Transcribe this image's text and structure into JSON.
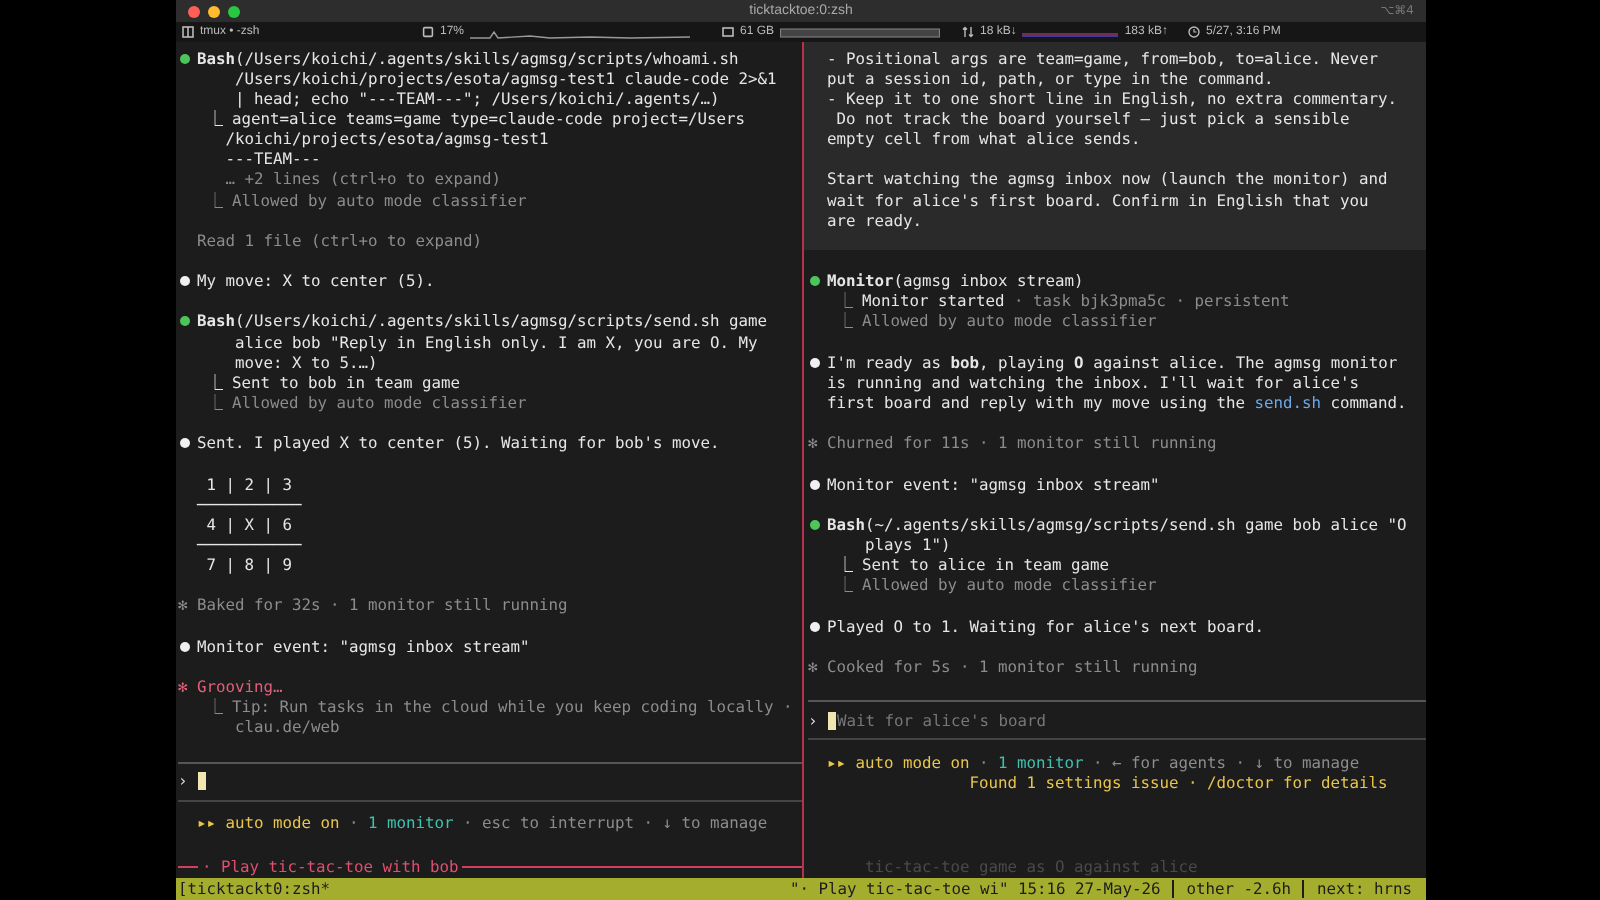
{
  "window": {
    "title": "ticktacktoe:0:zsh",
    "shortcut": "⌥⌘4"
  },
  "status_items": [
    {
      "kind": "session",
      "text": "tmux • -zsh"
    },
    {
      "kind": "cpu",
      "text": "17%"
    },
    {
      "kind": "memory",
      "text": "61 GB"
    },
    {
      "kind": "network",
      "down": "18 kB↓",
      "up": "183 kB↑"
    },
    {
      "kind": "clock",
      "text": "5/27, 3:16 PM"
    }
  ],
  "panes": [
    {
      "active": true,
      "lines": [
        {
          "kind": "tool",
          "text": "**Bash**(/Users/koichi/.agents/skills/agmsg/scripts/whoami.sh"
        },
        {
          "kind": "cont",
          "text": "/Users/koichi/projects/esota/agmsg-test1 claude-code 2>&1"
        },
        {
          "kind": "cont",
          "text": "| head; echo \"---TEAM---\"; /Users/koichi/.agents/…)"
        },
        {
          "kind": "result",
          "text": "⎿ agent=alice teams=game type=claude-code project=/Users"
        },
        {
          "kind": "result_cont",
          "text": "/koichi/projects/esota/agmsg-test1"
        },
        {
          "kind": "result_cont",
          "text": "---TEAM---"
        },
        {
          "kind": "result_cont_dim",
          "text": "… +2 lines (ctrl+o to expand)"
        },
        {
          "kind": "result_dim",
          "text": "⎿ Allowed by auto mode classifier"
        },
        {
          "kind": "blank"
        },
        {
          "kind": "note",
          "text": "Read 1 file (ctrl+o to expand)"
        },
        {
          "kind": "blank"
        },
        {
          "kind": "message",
          "text": "My move: X to center (5)."
        },
        {
          "kind": "blank"
        },
        {
          "kind": "tool",
          "text": "**Bash**(/Users/koichi/.agents/skills/agmsg/scripts/send.sh game"
        },
        {
          "kind": "cont",
          "text": "alice bob \"Reply in English only. I am X, you are O. My"
        },
        {
          "kind": "cont",
          "text": "move: X to 5.…)"
        },
        {
          "kind": "result",
          "text": "⎿ Sent to bob in team game"
        },
        {
          "kind": "result_dim",
          "text": "⎿ Allowed by auto mode classifier"
        },
        {
          "kind": "blank"
        },
        {
          "kind": "message",
          "text": "Sent. I played X to center (5). Waiting for bob's move."
        },
        {
          "kind": "blank"
        },
        {
          "kind": "board",
          "text": " 1 | 2 | 3"
        },
        {
          "kind": "board",
          "text": "───────────"
        },
        {
          "kind": "board",
          "text": " 4 | X | 6"
        },
        {
          "kind": "board",
          "text": "───────────"
        },
        {
          "kind": "board",
          "text": " 7 | 8 | 9"
        },
        {
          "kind": "blank"
        },
        {
          "kind": "spinner",
          "text": "✻ Baked for 32s · 1 monitor still running"
        },
        {
          "kind": "blank"
        },
        {
          "kind": "message",
          "text": "Monitor event: \"agmsg inbox stream\""
        },
        {
          "kind": "blank"
        },
        {
          "kind": "spinner_active",
          "text": "✻ Grooving…"
        },
        {
          "kind": "result_dim",
          "text": "⎿ Tip: Run tasks in the cloud while you keep coding locally ·"
        },
        {
          "kind": "cont_dim",
          "text": "clau.de/web"
        }
      ],
      "prompt": {
        "symbol": "›"
      },
      "footer": [
        {
          "kind": "status",
          "parts": [
            {
              "kind": "mode",
              "text": "▸▸ auto mode on"
            },
            {
              "kind": "dim",
              "text": " · "
            },
            {
              "kind": "monitor",
              "text": "1 monitor"
            },
            {
              "kind": "dim",
              "text": " · esc to interrupt · ↓ to manage"
            }
          ]
        }
      ],
      "title": "· Play tic-tac-toe with bob"
    },
    {
      "active": false,
      "message_block": [
        {
          "kind": "user",
          "text": "- Positional args are team=game, from=bob, to=alice. Never"
        },
        {
          "kind": "user",
          "text": "put a session id, path, or type in the command."
        },
        {
          "kind": "user",
          "text": "- Keep it to one short line in English, no extra commentary."
        },
        {
          "kind": "user",
          "text": " Do not track the board yourself — just pick a sensible"
        },
        {
          "kind": "user",
          "text": "empty cell from what alice sends."
        },
        {
          "kind": "blank"
        },
        {
          "kind": "user",
          "text": "Start watching the agmsg inbox now (launch the monitor) and"
        },
        {
          "kind": "user",
          "text": "wait for alice's first board. Confirm in English that you"
        },
        {
          "kind": "user",
          "text": "are ready."
        },
        {
          "kind": "blank"
        }
      ],
      "lines": [
        {
          "kind": "blank"
        },
        {
          "kind": "tool",
          "text": "**Monitor**(agmsg inbox stream)"
        },
        {
          "kind": "result",
          "parts": [
            {
              "kind": "dim",
              "text": "⎿ "
            },
            {
              "kind": "bright",
              "text": "Monitor started"
            },
            {
              "kind": "dim",
              "text": " · task bjk3pma5c · persistent"
            }
          ]
        },
        {
          "kind": "result_dim",
          "text": "⎿ Allowed by auto mode classifier"
        },
        {
          "kind": "blank"
        },
        {
          "kind": "message",
          "text": "I'm ready as **bob**, playing **O** against alice. The agmsg monitor"
        },
        {
          "kind": "message_cont",
          "text": "is running and watching the inbox. I'll wait for alice's"
        },
        {
          "kind": "message_cont",
          "parts": [
            {
              "kind": "bright",
              "text": "first board and reply with my move using the "
            },
            {
              "kind": "code",
              "text": "send.sh"
            },
            {
              "kind": "bright",
              "text": " command."
            }
          ]
        },
        {
          "kind": "blank"
        },
        {
          "kind": "spinner",
          "text": "✻ Churned for 11s · 1 monitor still running"
        },
        {
          "kind": "blank"
        },
        {
          "kind": "message",
          "text": "Monitor event: \"agmsg inbox stream\""
        },
        {
          "kind": "blank"
        },
        {
          "kind": "tool",
          "text": "**Bash**(~/.agents/skills/agmsg/scripts/send.sh game bob alice \"O"
        },
        {
          "kind": "cont",
          "text": "plays 1\")"
        },
        {
          "kind": "result",
          "text": "⎿ Sent to alice in team game"
        },
        {
          "kind": "result_dim",
          "text": "⎿ Allowed by auto mode classifier"
        },
        {
          "kind": "blank"
        },
        {
          "kind": "message",
          "text": "Played O to 1. Waiting for alice's next board."
        },
        {
          "kind": "blank"
        },
        {
          "kind": "spinner",
          "text": "✻ Cooked for 5s · 1 monitor still running"
        }
      ],
      "prompt": {
        "symbol": "›",
        "placeholder": "Wait for alice's board"
      },
      "footer": [
        {
          "kind": "status",
          "parts": [
            {
              "kind": "mode",
              "text": "▸▸ auto mode on"
            },
            {
              "kind": "dim",
              "text": " · "
            },
            {
              "kind": "monitor",
              "text": "1 monitor"
            },
            {
              "kind": "dim",
              "text": " · ← for agents · ↓ to manage"
            }
          ]
        },
        {
          "kind": "warning",
          "parts": [
            {
              "kind": "warn",
              "text": "Found 1 settings issue · /doctor for details"
            }
          ]
        }
      ],
      "title": "tic-tac-toe game as O against alice"
    }
  ],
  "tmux_bar": {
    "session": "[ticktackt0:zsh*",
    "segments": [
      "\"· Play tic-tac-toe wi\" 15:16 27-May-26",
      "other -2.6h",
      "next: hrns"
    ]
  }
}
